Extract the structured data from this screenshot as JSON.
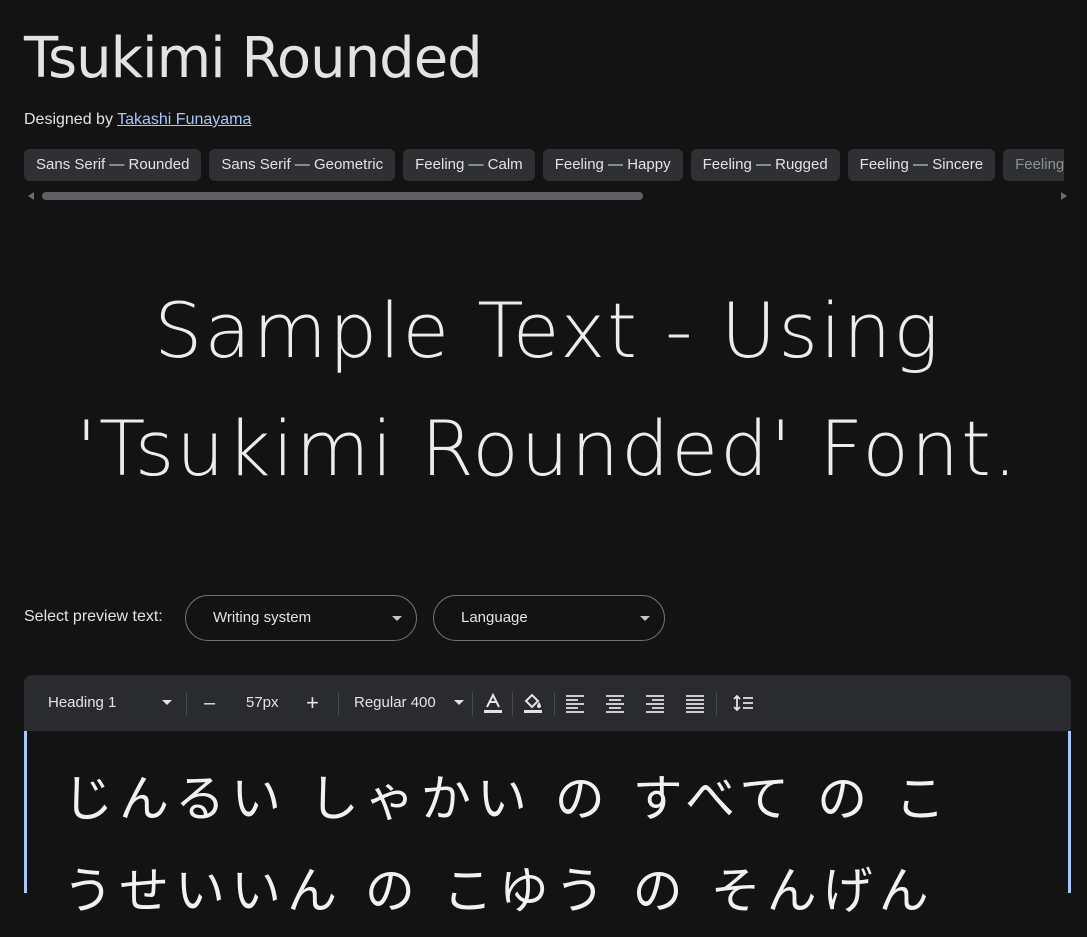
{
  "header": {
    "title": "Tsukimi Rounded",
    "designed_by": "Designed by",
    "designer": "Takashi Funayama"
  },
  "tags": [
    "Sans Serif — Rounded",
    "Sans Serif — Geometric",
    "Feeling — Calm",
    "Feeling — Happy",
    "Feeling — Rugged",
    "Feeling — Sincere",
    "Feeling —"
  ],
  "hero": {
    "line1": "Sample Text - Using",
    "line2": "'Tsukimi Rounded' Font."
  },
  "preview": {
    "label": "Select preview text:",
    "writing_system": "Writing system",
    "language": "Language"
  },
  "toolbar": {
    "style": "Heading 1",
    "minus": "–",
    "size": "57px",
    "plus": "+",
    "weight": "Regular 400"
  },
  "editor": {
    "text": "じんるい しゃかい の すべて の こうせいいん の こゆう の そんげん"
  },
  "colors": {
    "background": "#131314",
    "link": "#a8c7fa",
    "chip": "#2f3033",
    "toolbar": "#2a2b2e"
  }
}
